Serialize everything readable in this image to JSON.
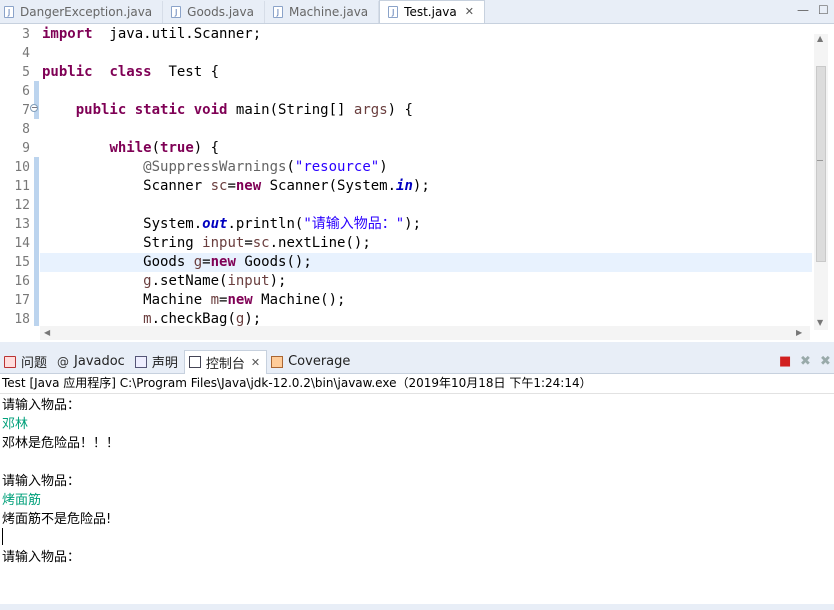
{
  "editor_tabs": [
    {
      "label": "DangerException.java",
      "active": false
    },
    {
      "label": "Goods.java",
      "active": false
    },
    {
      "label": "Machine.java",
      "active": false
    },
    {
      "label": "Test.java",
      "active": true
    }
  ],
  "editor_tab_close": "✕",
  "window_controls": {
    "minimize": "—",
    "maximize": "☐"
  },
  "code_lines": [
    {
      "n": "3",
      "segs": [
        [
          "kw",
          "import"
        ],
        [
          "",
          "  java.util.Scanner;"
        ]
      ]
    },
    {
      "n": "4",
      "segs": []
    },
    {
      "n": "5",
      "segs": [
        [
          "kw",
          "public"
        ],
        [
          "",
          "  "
        ],
        [
          "kw",
          "class"
        ],
        [
          "",
          "  Test {"
        ]
      ]
    },
    {
      "n": "6",
      "segs": []
    },
    {
      "n": "7",
      "segs": [
        [
          "",
          "    "
        ],
        [
          "kw",
          "public"
        ],
        [
          "",
          " "
        ],
        [
          "kw",
          "static"
        ],
        [
          "",
          " "
        ],
        [
          "kw",
          "void"
        ],
        [
          "",
          " main(String[] "
        ],
        [
          "var",
          "args"
        ],
        [
          "",
          ") {"
        ]
      ]
    },
    {
      "n": "8",
      "segs": []
    },
    {
      "n": "9",
      "segs": [
        [
          "",
          "        "
        ],
        [
          "kw",
          "while"
        ],
        [
          "",
          "("
        ],
        [
          "kw",
          "true"
        ],
        [
          "",
          ") {"
        ]
      ]
    },
    {
      "n": "10",
      "segs": [
        [
          "",
          "            "
        ],
        [
          "ann",
          "@SuppressWarnings"
        ],
        [
          "",
          "("
        ],
        [
          "str",
          "\"resource\""
        ],
        [
          "",
          ")"
        ]
      ]
    },
    {
      "n": "11",
      "segs": [
        [
          "",
          "            Scanner "
        ],
        [
          "var",
          "sc"
        ],
        [
          "",
          "="
        ],
        [
          "kw",
          "new"
        ],
        [
          "",
          " Scanner(System."
        ],
        [
          "fld",
          "in"
        ],
        [
          "",
          ");"
        ]
      ]
    },
    {
      "n": "12",
      "segs": []
    },
    {
      "n": "13",
      "segs": [
        [
          "",
          "            System."
        ],
        [
          "fld",
          "out"
        ],
        [
          "",
          ".println("
        ],
        [
          "str",
          "\"请输入物品：\""
        ],
        [
          "",
          ");"
        ]
      ]
    },
    {
      "n": "14",
      "segs": [
        [
          "",
          "            String "
        ],
        [
          "var",
          "input"
        ],
        [
          "",
          "="
        ],
        [
          "var",
          "sc"
        ],
        [
          "",
          ".nextLine();"
        ]
      ]
    },
    {
      "n": "15",
      "segs": [
        [
          "",
          "            Goods "
        ],
        [
          "var",
          "g"
        ],
        [
          "",
          "="
        ],
        [
          "kw",
          "new"
        ],
        [
          "",
          " Goods();"
        ]
      ]
    },
    {
      "n": "16",
      "segs": [
        [
          "",
          "            "
        ],
        [
          "var",
          "g"
        ],
        [
          "",
          ".setName("
        ],
        [
          "var",
          "input"
        ],
        [
          "",
          ");"
        ]
      ]
    },
    {
      "n": "17",
      "segs": [
        [
          "",
          "            Machine "
        ],
        [
          "var",
          "m"
        ],
        [
          "",
          "="
        ],
        [
          "kw",
          "new"
        ],
        [
          "",
          " Machine();"
        ]
      ]
    },
    {
      "n": "18",
      "segs": [
        [
          "",
          "            "
        ],
        [
          "var",
          "m"
        ],
        [
          "",
          ".checkBag("
        ],
        [
          "var",
          "g"
        ],
        [
          "",
          ");"
        ]
      ]
    }
  ],
  "panel_tabs": [
    {
      "label": "问题",
      "icon": "problems-icon",
      "active": false
    },
    {
      "label": "Javadoc",
      "icon": "javadoc-icon",
      "active": false
    },
    {
      "label": "声明",
      "icon": "declaration-icon",
      "active": false
    },
    {
      "label": "控制台",
      "icon": "console-icon",
      "active": true
    },
    {
      "label": "Coverage",
      "icon": "coverage-icon",
      "active": false
    }
  ],
  "panel_tab_close": "✕",
  "console_header": "Test [Java 应用程序] C:\\Program Files\\Java\\jdk-12.0.2\\bin\\javaw.exe（2019年10月18日 下午1:24:14）",
  "console_lines": [
    {
      "text": "请输入物品：",
      "input": false
    },
    {
      "text": "邓林",
      "input": true
    },
    {
      "text": "邓林是危险品！！！",
      "input": false
    },
    {
      "text": "",
      "input": false
    },
    {
      "text": "请输入物品：",
      "input": false
    },
    {
      "text": "烤面筋",
      "input": true
    },
    {
      "text": "烤面筋不是危险品!",
      "input": false
    },
    {
      "text": "",
      "input": false
    },
    {
      "text": "请输入物品：",
      "input": false
    }
  ],
  "colors": {
    "keyword": "#7f0055",
    "string": "#2a00ff",
    "console_input": "#00a07a",
    "current_line": "#e8f2fe"
  }
}
